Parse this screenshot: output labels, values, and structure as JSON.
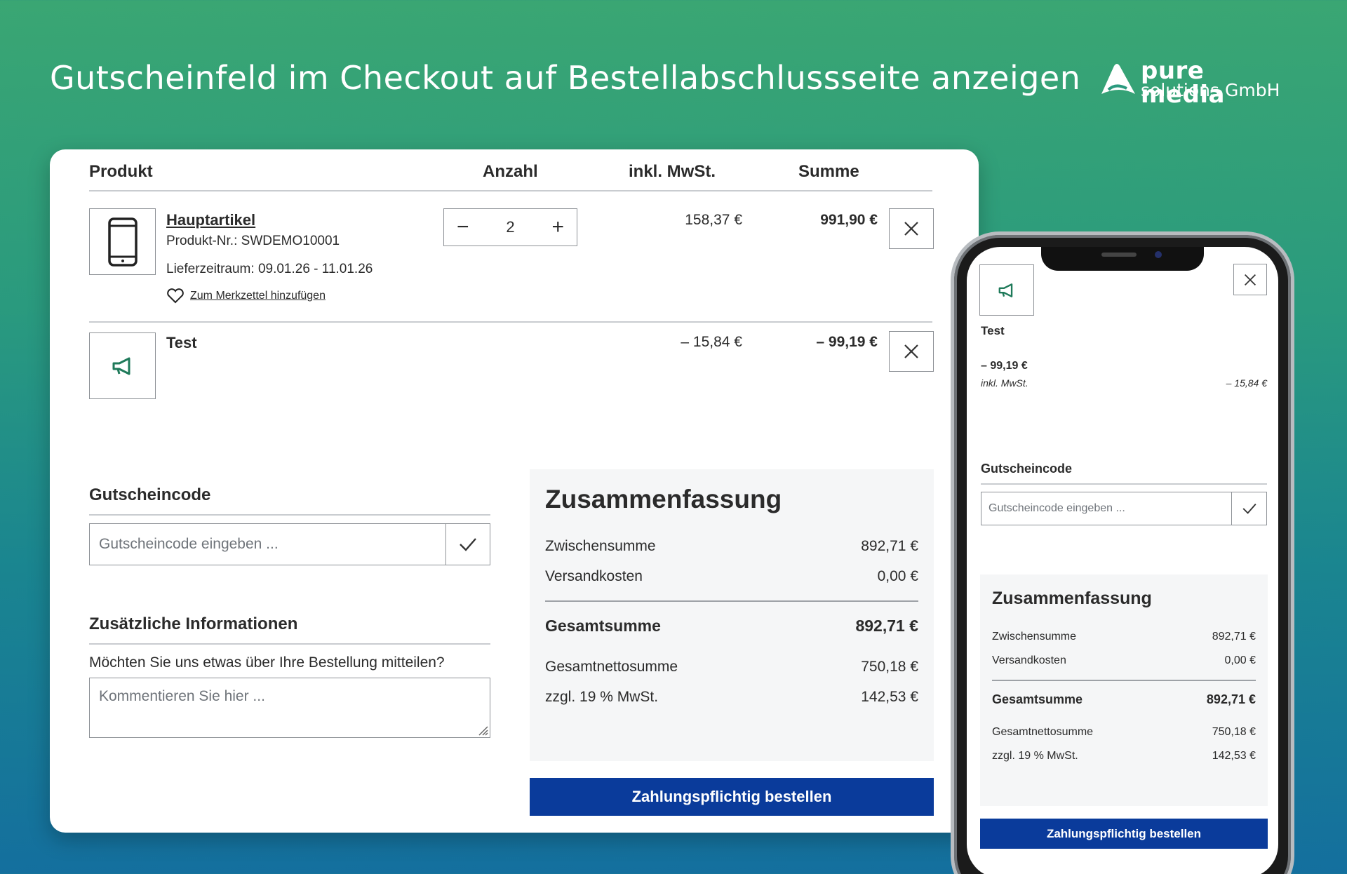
{
  "headline": "Gutscheinfeld im Checkout auf Bestellabschlussseite anzeigen",
  "logo": {
    "line1": "pure media",
    "line2": "solutions GmbH"
  },
  "table": {
    "col_product": "Produkt",
    "col_quantity": "Anzahl",
    "col_tax": "inkl. MwSt.",
    "col_total": "Summe"
  },
  "item1": {
    "name": "Hauptartikel",
    "number": "Produkt-Nr.: SWDEMO10001",
    "delivery": "Lieferzeitraum: 09.01.26 - 11.01.26",
    "wishlist": "Zum Merkzettel hinzufügen",
    "quantity": "2",
    "unit_price": "158,37 €",
    "total": "991,90 €"
  },
  "item2": {
    "name": "Test",
    "unit_price": "– 15,84 €",
    "total": "– 99,19 €"
  },
  "voucher": {
    "title": "Gutscheincode",
    "placeholder": "Gutscheincode eingeben ..."
  },
  "info": {
    "title": "Zusätzliche Informationen",
    "question": "Möchten Sie uns etwas über Ihre Bestellung mitteilen?",
    "placeholder": "Kommentieren Sie hier ..."
  },
  "summary": {
    "title": "Zusammenfassung",
    "subtotal_label": "Zwischensumme",
    "subtotal": "892,71 €",
    "shipping_label": "Versandkosten",
    "shipping": "0,00 €",
    "grand_label": "Gesamtsumme",
    "grand": "892,71 €",
    "net_label": "Gesamtnettosumme",
    "net": "750,18 €",
    "tax_label": "zzgl. 19 % MwSt.",
    "tax": "142,53 €"
  },
  "order_button": "Zahlungspflichtig bestellen",
  "mobile": {
    "item_name": "Test",
    "item_total": "– 99,19 €",
    "tax_label": "inkl. MwSt.",
    "unit_price": "– 15,84 €",
    "voucher_title": "Gutscheincode",
    "voucher_placeholder": "Gutscheincode eingeben ..."
  },
  "colors": {
    "accent": "#0a3b9b",
    "icon_green": "#1f7a5a"
  }
}
